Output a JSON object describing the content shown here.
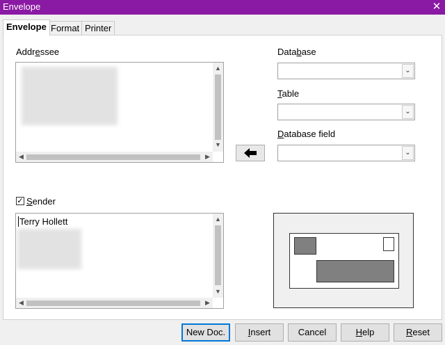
{
  "window": {
    "title": "Envelope",
    "close_icon": "close-icon"
  },
  "tabs": [
    "Envelope",
    "Format",
    "Printer"
  ],
  "addressee": {
    "label_pre": "Addr",
    "label_u": "e",
    "label_post": "ssee"
  },
  "sender": {
    "label_u": "S",
    "label_post": "ender",
    "checked": true,
    "text": "Terry Hollett"
  },
  "database": {
    "label_pre": "Data",
    "label_u": "b",
    "label_post": "ase",
    "value": ""
  },
  "table": {
    "label_u": "T",
    "label_post": "able",
    "value": ""
  },
  "database_field": {
    "label_u": "D",
    "label_post": "atabase field",
    "value": ""
  },
  "buttons": {
    "new_doc": "New Doc.",
    "insert_u": "I",
    "insert_post": "nsert",
    "cancel": "Cancel",
    "help_u": "H",
    "help_post": "elp",
    "reset_u": "R",
    "reset_post": "eset"
  },
  "icons": {
    "insert_field": "arrow-left-icon"
  }
}
